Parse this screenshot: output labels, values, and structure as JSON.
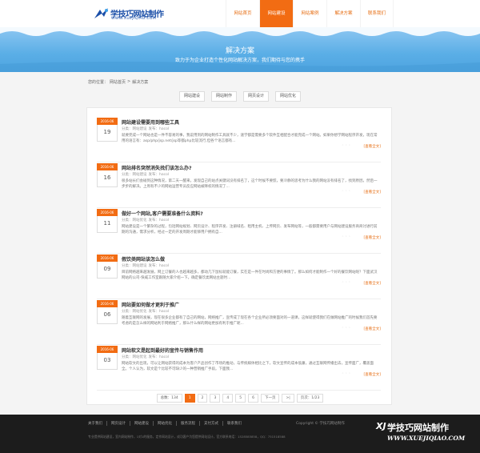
{
  "brand": {
    "name": "学技巧网站制作",
    "url": "WWW.XUEJIQIAO.COM"
  },
  "nav": [
    {
      "label": "网站首页",
      "active": false
    },
    {
      "label": "网站建设",
      "active": true
    },
    {
      "label": "网站案例",
      "active": false
    },
    {
      "label": "解决方案",
      "active": false
    },
    {
      "label": "联系我们",
      "active": false
    }
  ],
  "banner": {
    "title": "解决方案",
    "subtitle": "致力于为企业打造个性化网站解决方案，我们期待与您的携手"
  },
  "breadcrumb": {
    "prefix": "您的位置：",
    "home": "网站首页",
    "sep": ">",
    "current": "解决方案"
  },
  "tabs": [
    "网站建设",
    "网站制作",
    "网页设计",
    "网站优化"
  ],
  "articles": [
    {
      "month": "2016-06",
      "day": "19",
      "title": "网站建设需要用到哪些工具",
      "category": "分类：网站建设",
      "author": "发布：hacol",
      "body": "就要完成一个网站也是一件不容易的事，我说用到的网站制作工具就不少，速学都是需要多个软件互相配合才能完成一个网站。如果你想学网站程序开发，现在常用的语言有：asp/php/jsp.net/jsp等都php比较流行,但各个语言都有...",
      "more": "[查看全文]"
    },
    {
      "month": "2016-06",
      "day": "16",
      "title": "网站排名突然消失找们该怎么办?",
      "category": "分类：网站建设",
      "author": "发布：hacol",
      "body": "很多站长们会碰到这种情况，第二天一醒来，发现自己的站点关键词没有排名了，这个时候不要慌，要冷静的思考为什么我的网站没有排名了，找到原因，然后一步步的解决。上周有不少的网站运营专员反应网站被降权的情况了...",
      "more": "[查看全文]"
    },
    {
      "month": "2016-06",
      "day": "11",
      "title": "做好一个网站,客户需要准备什么资料?",
      "category": "分类：网站优化",
      "author": "发布：hacol",
      "body": "网站建设是一个繁杂的过程，包括网站规划、网页设计、程序开发、注册域名、租用主机、上传网页、发布网站等，一般都需要用户与网站建设服务商商讨进行前期的沟通，需求分析，经过一定的开发周期才能够用户拥有自...",
      "more": "[查看全文]"
    },
    {
      "month": "2016-06",
      "day": "09",
      "title": "假饮类网站该怎么做",
      "category": "分类：网站建设",
      "author": "发布：hacol",
      "body": "目前网络越来越发展，网上订餐的人也越来越多，都动几下鼠标就能订餐，实在是一件在时尚和方便的事情了。那么如何才能制作一个好的餐饮网站呢？下面武汉网站的公司-快威工作室跟随大家介绍一下。确定餐饮类网站主题时...",
      "more": "[查看全文]"
    },
    {
      "month": "2016-06",
      "day": "06",
      "title": "网站要如何做才更利于推广",
      "category": "分类：网站优化",
      "author": "发布：hacol",
      "body": "随着互联网的发展，现在很多企业都有了自己的网站，网络推广，宣传成了现在各个企业所必须要面对的一道课，这样就使得我们在做网站推广的时候我们首先要考虑的是怎么样的网站利于网络推广，那么什么样的网站更加有利于推广呢...",
      "more": "[查看全文]"
    },
    {
      "month": "2016-06",
      "day": "03",
      "title": "网站软文是起到最好的宣传与销售作用",
      "category": "分类：网站优化",
      "author": "发布：hacol",
      "body": "网站软文的出现，可以让网站获得的成本为客户产品创作了市场的推动，与传统媒体相比之下，软文宣传的成本低廉，通过互联网传播出去，宣传面广，覆盖面全。个人认为，软文是个比较不可缺少的一种营销推广手段。下面我...",
      "more": "[查看全文]"
    }
  ],
  "pager": {
    "total": "总数：134",
    "pages": [
      "1",
      "2",
      "3",
      "4",
      "5",
      "6"
    ],
    "active": "1",
    "next": "下一页",
    "last": ">|",
    "info": "页次：1/23"
  },
  "footer": {
    "links": [
      "关于我们",
      "网页设计",
      "网站建设",
      "网站优化",
      "服务流程",
      "支付方式",
      "联系我们"
    ],
    "copyright": "Copyright © 学技巧网站制作",
    "info": "专业提供网站建设，室内网站制作，1对1的服务，定作网站设计，成功客户为您提供网站设计，官方联系电话：1528585858，QQ：751518588"
  },
  "colors": {
    "accent": "#f26c13",
    "brand_blue": "#1b4fa8",
    "banner_blue": "#5aaee6",
    "footer_bg": "#1c1c1c"
  },
  "watermark": {
    "brand": "学技巧网站制作",
    "url": "WWW.XUEJIQIAO.COM"
  }
}
